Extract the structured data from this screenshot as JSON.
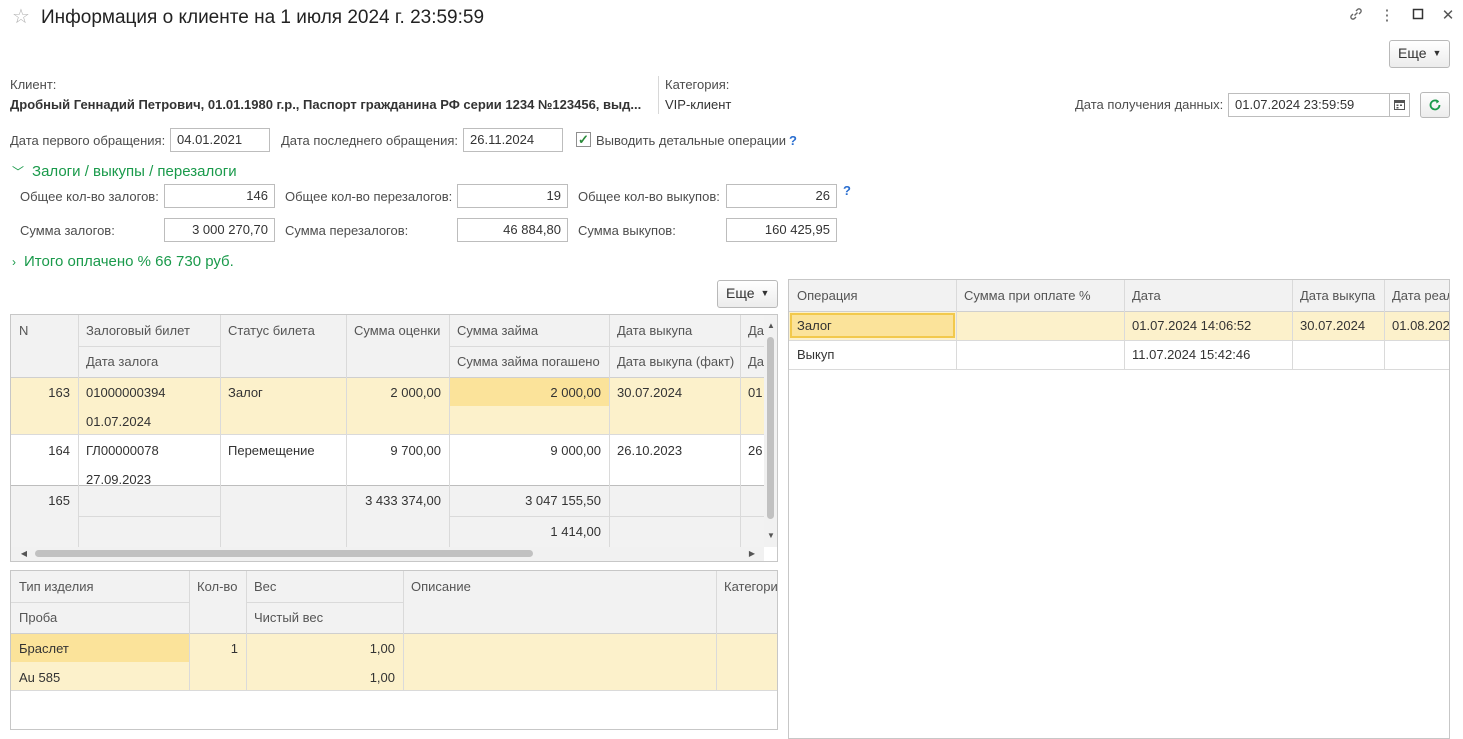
{
  "window": {
    "title": "Информация о клиенте на 1 июля 2024 г. 23:59:59",
    "more_label": "Еще"
  },
  "client": {
    "label": "Клиент:",
    "value": "Дробный Геннадий Петрович, 01.01.1980 г.р., Паспорт гражданина РФ серии 1234 №123456, выд..."
  },
  "category": {
    "label": "Категория:",
    "value": "VIP-клиент"
  },
  "data_date": {
    "label": "Дата получения данных:",
    "value": "01.07.2024 23:59:59"
  },
  "first_visit": {
    "label": "Дата первого обращения:",
    "value": "04.01.2021"
  },
  "last_visit": {
    "label": "Дата последнего обращения:",
    "value": "26.11.2024"
  },
  "detail_ops": {
    "label": "Выводить детальные операции",
    "checked": true,
    "help": "?"
  },
  "pledges_section": {
    "title": "Залоги / выкупы / перезалоги",
    "total_pledges_label": "Общее кол-во залогов:",
    "total_pledges": "146",
    "total_repledges_label": "Общее кол-во перезалогов:",
    "total_repledges": "19",
    "total_buyouts_label": "Общее кол-во выкупов:",
    "total_buyouts": "26",
    "help": "?",
    "sum_pledges_label": "Сумма залогов:",
    "sum_pledges": "3 000 270,70",
    "sum_repledges_label": "Сумма перезалогов:",
    "sum_repledges": "46 884,80",
    "sum_buyouts_label": "Сумма выкупов:",
    "sum_buyouts": "160 425,95"
  },
  "paid_section": {
    "title": "Итого оплачено % 66 730 руб."
  },
  "left_table": {
    "more_label": "Еще",
    "headers": {
      "n": "N",
      "ticket": "Залоговый билет",
      "pledge_date": "Дата залога",
      "status": "Статус билета",
      "estimate": "Сумма оценки",
      "loan": "Сумма займа",
      "loan_repaid": "Сумма займа погашено",
      "buyout_date": "Дата выкупа",
      "buyout_fact": "Дата выкупа (факт)",
      "extra": "Да",
      "extra2": "Да"
    },
    "rows": [
      {
        "n": "163",
        "ticket": "01000000394",
        "pledge_date": "01.07.2024",
        "status": "Залог",
        "estimate": "2 000,00",
        "loan": "2 000,00",
        "loan_repaid": "",
        "buyout_date": "30.07.2024",
        "buyout_fact": "",
        "extra": "01"
      },
      {
        "n": "164",
        "ticket": "ГЛ00000078",
        "pledge_date": "27.09.2023",
        "status": "Перемещение",
        "estimate": "9 700,00",
        "loan": "9 000,00",
        "loan_repaid": "",
        "buyout_date": "26.10.2023",
        "buyout_fact": "",
        "extra": "26"
      }
    ],
    "footer": {
      "n": "165",
      "estimate": "3 433 374,00",
      "loan": "3 047 155,50",
      "loan_repaid": "1 414,00"
    }
  },
  "items_table": {
    "headers": {
      "type": "Тип изделия",
      "probe": "Проба",
      "qty": "Кол-во",
      "weight": "Вес",
      "net_weight": "Чистый вес",
      "description": "Описание",
      "category": "Категори"
    },
    "rows": [
      {
        "type": "Браслет",
        "probe": "Au 585",
        "qty": "1",
        "weight": "1,00",
        "net_weight": "1,00",
        "description": "",
        "category": ""
      }
    ]
  },
  "ops_table": {
    "headers": {
      "operation": "Операция",
      "pct_sum": "Сумма при оплате %",
      "date": "Дата",
      "buyout_date": "Дата выкупа",
      "sale_date": "Дата реал"
    },
    "rows": [
      {
        "operation": "Залог",
        "pct_sum": "",
        "date": "01.07.2024 14:06:52",
        "buyout_date": "30.07.2024",
        "sale_date": "01.08.202"
      },
      {
        "operation": "Выкуп",
        "pct_sum": "",
        "date": "11.07.2024 15:42:46",
        "buyout_date": "",
        "sale_date": ""
      }
    ]
  },
  "colors": {
    "accent_green": "#1a9a4b",
    "row_highlight": "#fcf1cb",
    "cell_selected": "#fbe39a"
  },
  "icons": [
    "star-icon",
    "link-icon",
    "kebab-menu-icon",
    "maximize-icon",
    "close-icon",
    "calendar-icon",
    "refresh-icon",
    "chevron-down-icon",
    "chevron-right-icon"
  ]
}
